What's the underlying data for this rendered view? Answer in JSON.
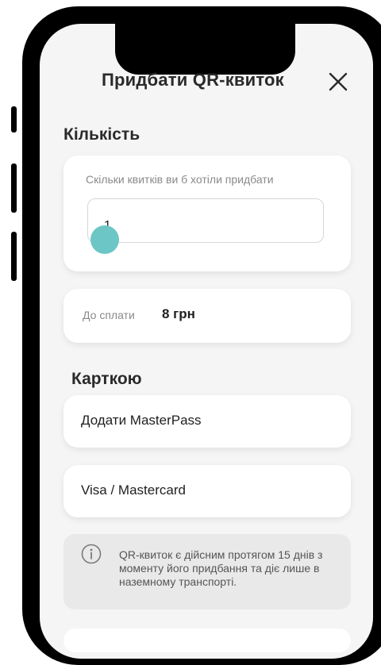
{
  "header": {
    "title": "Придбати QR-квиток"
  },
  "quantity": {
    "section_title": "Кількість",
    "hint": "Скільки квитків ви б хотіли придбати",
    "value": "1"
  },
  "payment_due": {
    "label": "До сплати",
    "amount": "8 грн"
  },
  "card_payment": {
    "section_title": "Карткою",
    "options": [
      "Додати MasterPass",
      "Visa / Mastercard"
    ]
  },
  "info": {
    "text": "QR-квиток є дійсним протягом 15 днів з моменту його придбання та діє лише в наземному транспорті."
  },
  "colors": {
    "accent_teal": "#6cc6c6",
    "background": "#f5f5f5"
  }
}
